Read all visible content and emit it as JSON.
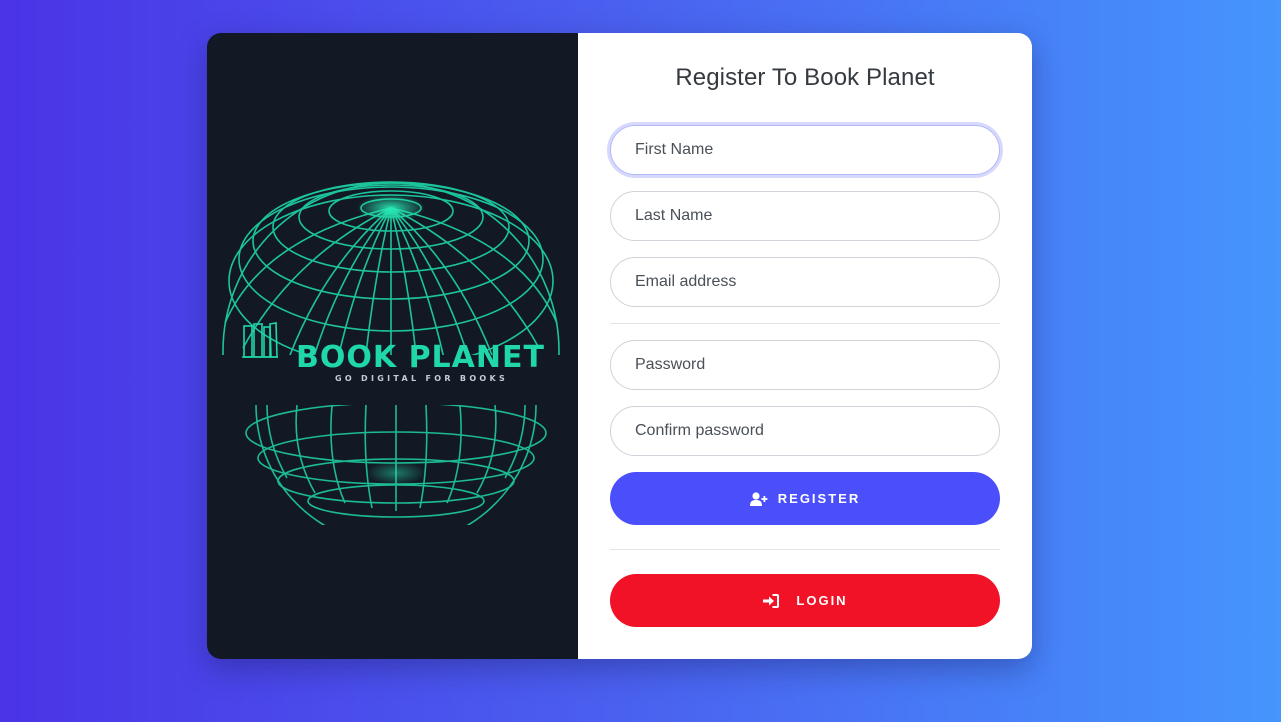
{
  "brand": {
    "name": "BOOK PLANET",
    "tagline": "GO DIGITAL FOR BOOKS",
    "accent_color": "#1fd7a8"
  },
  "form": {
    "title": "Register To Book Planet",
    "fields": {
      "first_name_placeholder": "First Name",
      "last_name_placeholder": "Last Name",
      "email_placeholder": "Email address",
      "password_placeholder": "Password",
      "confirm_password_placeholder": "Confirm password"
    },
    "register_label": "REGISTER",
    "register_icon": "user-plus-icon",
    "login_label": "LOGIN",
    "login_icon": "sign-in-icon"
  },
  "colors": {
    "register_button": "#4a4ffb",
    "login_button": "#f21227",
    "left_panel": "#121925"
  }
}
